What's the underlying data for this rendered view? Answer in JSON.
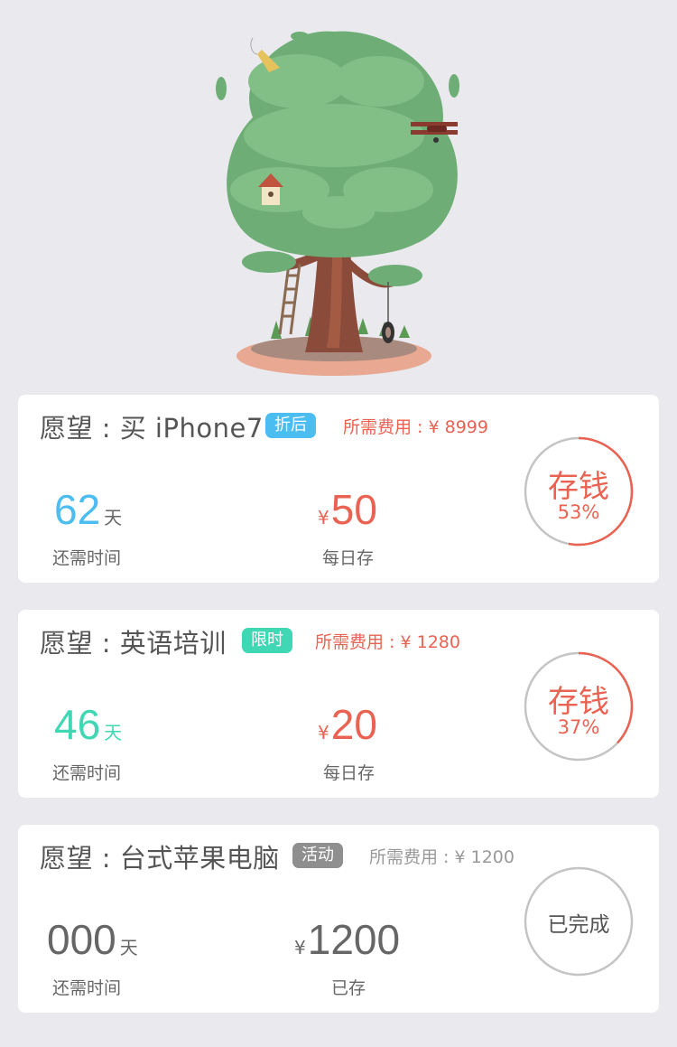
{
  "colors": {
    "blue": "#4bbdf0",
    "teal": "#3fd7b4",
    "red": "#ea6352",
    "gray": "#8f8f8f",
    "ring_track": "#c4c4c4"
  },
  "hero": {
    "illustration": "tree-house-illustration"
  },
  "cards": [
    {
      "title": "愿望 : 买 iPhone7",
      "tag": "折后",
      "cost": "所需费用 : ¥ 8999",
      "days_value": "62",
      "days_unit": "天",
      "days_label": "还需时间",
      "yen": "¥",
      "amount": "50",
      "amount_label": "每日存",
      "button_label": "存钱",
      "progress_text": "53%",
      "progress": 0.53
    },
    {
      "title": "愿望 : 英语培训",
      "tag": "限时",
      "cost": "所需费用 : ¥ 1280",
      "days_value": "46",
      "days_unit": "天",
      "days_label": "还需时间",
      "yen": "¥",
      "amount": "20",
      "amount_label": "每日存",
      "button_label": "存钱",
      "progress_text": "37%",
      "progress": 0.37
    },
    {
      "title": "愿望 : 台式苹果电脑",
      "tag": "活动",
      "cost": "所需费用 : ¥ 1200",
      "days_value": "000",
      "days_unit": "天",
      "days_label": "还需时间",
      "yen": "¥",
      "amount": "1200",
      "amount_label": "已存",
      "button_label": "已完成",
      "progress": 1.0
    }
  ]
}
